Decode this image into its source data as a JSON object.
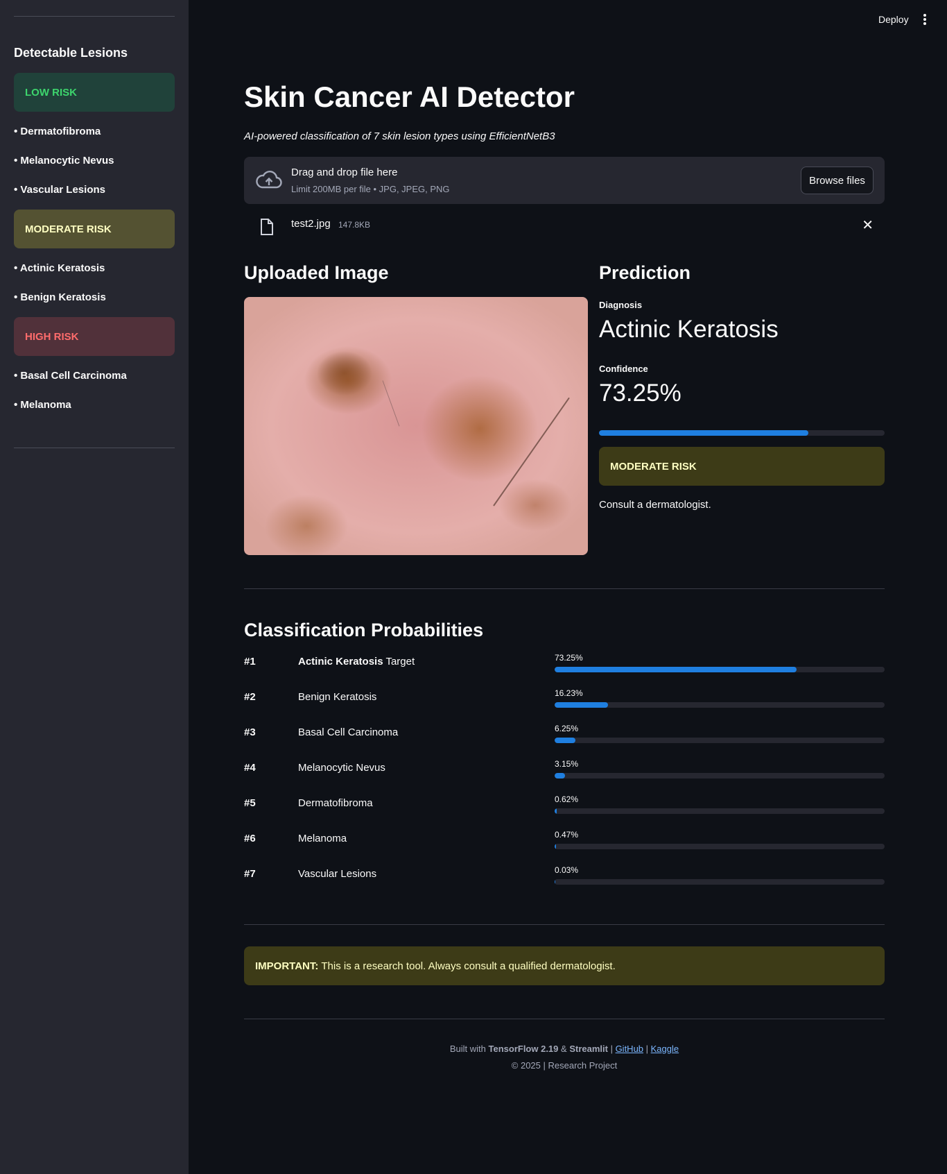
{
  "sidebar": {
    "title": "Detectable Lesions",
    "low_risk_label": "LOW RISK",
    "low_items": [
      "• Dermatofibroma",
      "• Melanocytic Nevus",
      "• Vascular Lesions"
    ],
    "moderate_risk_label": "MODERATE RISK",
    "moderate_items": [
      "• Actinic Keratosis",
      "• Benign Keratosis"
    ],
    "high_risk_label": "HIGH RISK",
    "high_items": [
      "• Basal Cell Carcinoma",
      "• Melanoma"
    ]
  },
  "header": {
    "deploy_label": "Deploy"
  },
  "main": {
    "title": "Skin Cancer AI Detector",
    "subtitle": "AI-powered classification of 7 skin lesion types using EfficientNetB3"
  },
  "uploader": {
    "drag_text": "Drag and drop file here",
    "limit_text": "Limit 200MB per file • JPG, JPEG, PNG",
    "browse_label": "Browse files",
    "file_name": "test2.jpg",
    "file_size": "147.8KB"
  },
  "uploaded_section": {
    "heading": "Uploaded Image"
  },
  "prediction": {
    "heading": "Prediction",
    "diagnosis_label": "Diagnosis",
    "diagnosis_value": "Actinic Keratosis",
    "confidence_label": "Confidence",
    "confidence_value": "73.25%",
    "confidence_fraction": 0.7325,
    "risk_label": "MODERATE RISK",
    "advice": "Consult a dermatologist."
  },
  "probabilities": {
    "heading": "Classification Probabilities",
    "rows": [
      {
        "rank": "#1",
        "name": "Actinic Keratosis",
        "tag": " Target",
        "pct": "73.25%",
        "value": 73.25
      },
      {
        "rank": "#2",
        "name": "Benign Keratosis",
        "tag": "",
        "pct": "16.23%",
        "value": 16.23
      },
      {
        "rank": "#3",
        "name": "Basal Cell Carcinoma",
        "tag": "",
        "pct": "6.25%",
        "value": 6.25
      },
      {
        "rank": "#4",
        "name": "Melanocytic Nevus",
        "tag": "",
        "pct": "3.15%",
        "value": 3.15
      },
      {
        "rank": "#5",
        "name": "Dermatofibroma",
        "tag": "",
        "pct": "0.62%",
        "value": 0.62
      },
      {
        "rank": "#6",
        "name": "Melanoma",
        "tag": "",
        "pct": "0.47%",
        "value": 0.47
      },
      {
        "rank": "#7",
        "name": "Vascular Lesions",
        "tag": "",
        "pct": "0.03%",
        "value": 0.03
      }
    ]
  },
  "important": {
    "label": "IMPORTANT:",
    "text": "This is a research tool. Always consult a qualified dermatologist."
  },
  "footer": {
    "built_with": "Built with ",
    "tensorflow": "TensorFlow 2.19",
    "amp": " & ",
    "streamlit": "Streamlit",
    "sep1": " | ",
    "github": "GitHub",
    "sep2": " | ",
    "kaggle": "Kaggle",
    "copyright": "© 2025 | Research Project"
  },
  "colors": {
    "background": "#0e1117",
    "sidebar": "#262730",
    "accent": "#1f7fe0",
    "low_risk": "#3dd56d",
    "moderate_risk": "#ffffc2",
    "high_risk": "#ff6c6c"
  }
}
